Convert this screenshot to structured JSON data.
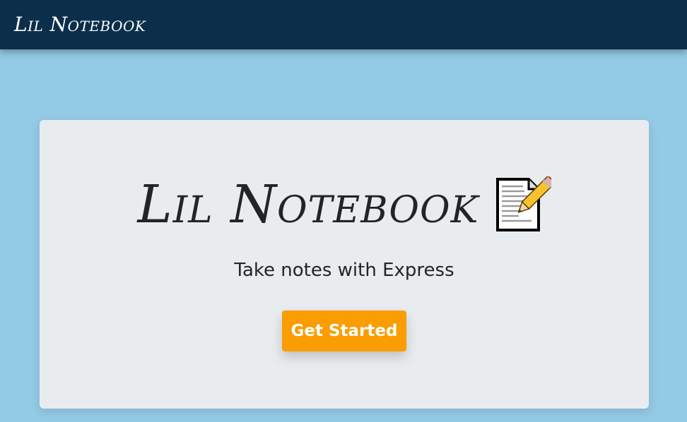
{
  "navbar": {
    "brand": "Lil Notebook"
  },
  "hero": {
    "title": "Lil Notebook",
    "icon": "memo-icon",
    "subtitle": "Take notes with Express",
    "button_label": "Get Started"
  },
  "colors": {
    "navbar_bg": "#0b2f4a",
    "page_bg": "#93cae6",
    "card_bg": "#e9ecef",
    "button_bg": "#f99d00",
    "button_text": "#ffffff"
  }
}
